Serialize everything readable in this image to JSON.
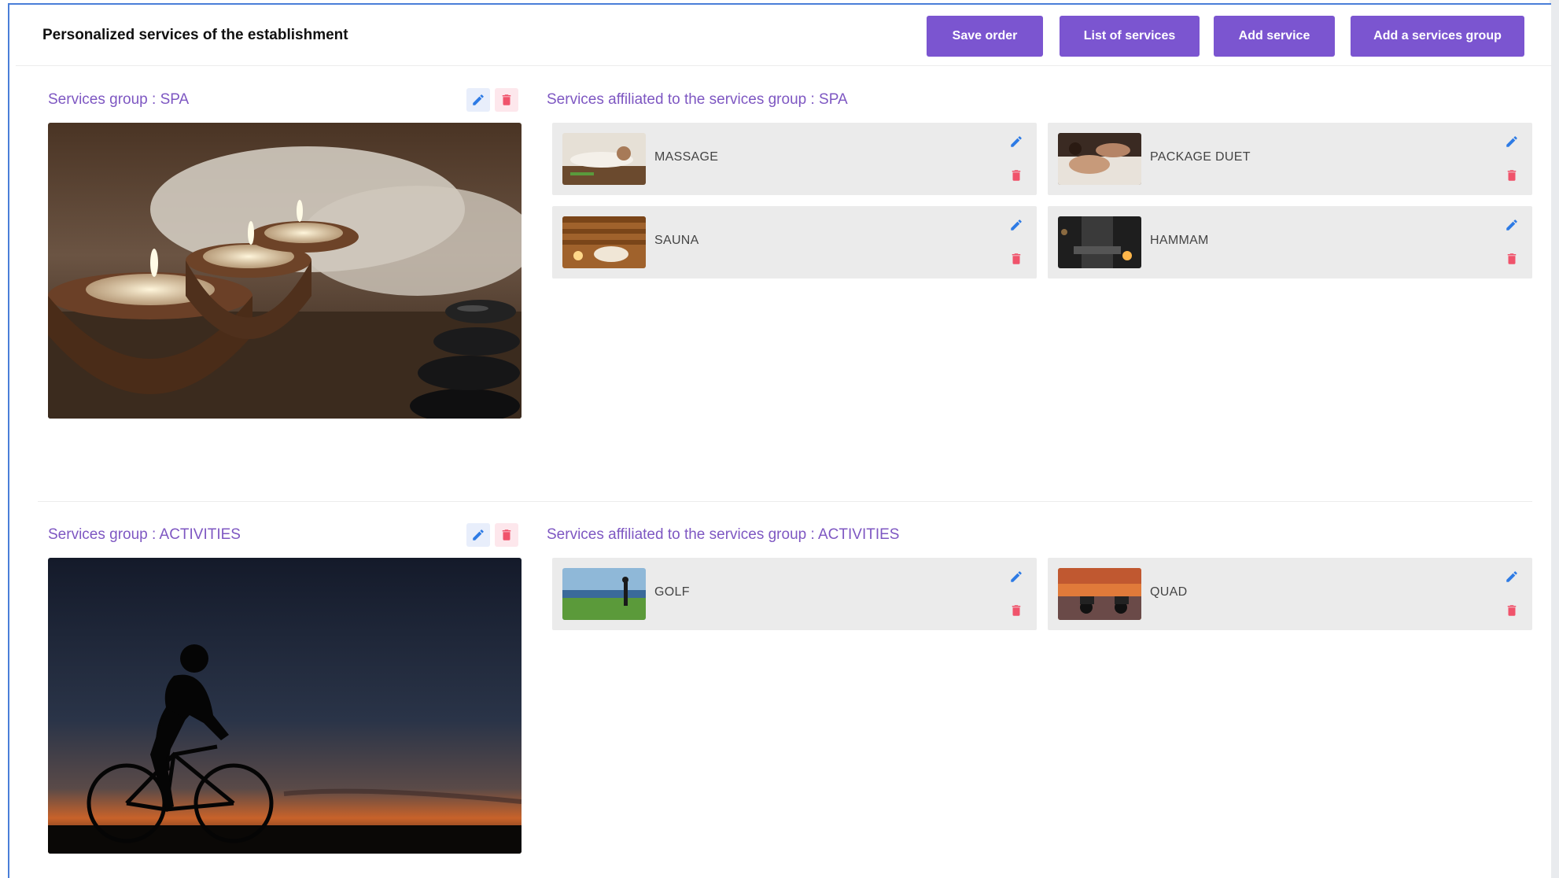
{
  "header": {
    "title": "Personalized services of the establishment",
    "buttons": {
      "save_order": "Save order",
      "list_services": "List of services",
      "add_service": "Add service",
      "add_group": "Add a services group"
    }
  },
  "colors": {
    "accent": "#7b55d0",
    "label": "#7e57c2",
    "edit_icon": "#2e7be5",
    "delete_icon": "#f0536b",
    "card_bg": "#ebebeb"
  },
  "groups": [
    {
      "label": "Services group : SPA",
      "affiliated_label": "Services affiliated to the services group : SPA",
      "image": "spa-candles-photo",
      "services": [
        {
          "name": "MASSAGE",
          "image": "massage-photo"
        },
        {
          "name": "PACKAGE DUET",
          "image": "package-duet-photo"
        },
        {
          "name": "SAUNA",
          "image": "sauna-photo"
        },
        {
          "name": "HAMMAM",
          "image": "hammam-photo"
        }
      ]
    },
    {
      "label": "Services group : ACTIVITIES",
      "affiliated_label": "Services affiliated to the services group : ACTIVITIES",
      "image": "cyclist-sunset-photo",
      "services": [
        {
          "name": "GOLF",
          "image": "golf-photo"
        },
        {
          "name": "QUAD",
          "image": "quad-photo"
        }
      ]
    }
  ],
  "icons": {
    "edit": "pencil-icon",
    "delete": "trash-icon"
  }
}
